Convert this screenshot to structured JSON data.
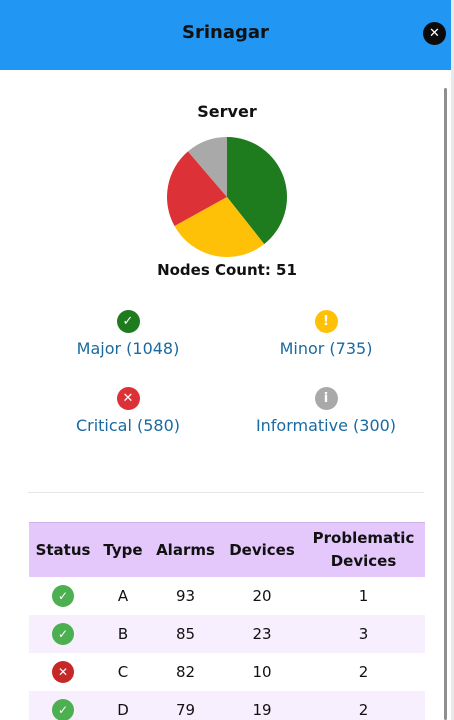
{
  "header": {
    "title": "Srinagar",
    "close_icon": "close-icon"
  },
  "chart": {
    "title": "Server",
    "nodes_count_label": "Nodes Count: 51"
  },
  "chart_data": {
    "type": "pie",
    "title": "Server",
    "slices": [
      {
        "label": "Major",
        "value": 1048,
        "color": "#1e7b1e"
      },
      {
        "label": "Minor",
        "value": 735,
        "color": "#ffc107"
      },
      {
        "label": "Critical",
        "value": 580,
        "color": "#dc3237"
      },
      {
        "label": "Informative",
        "value": 300,
        "color": "#a9a9a9"
      }
    ]
  },
  "legend": [
    {
      "label": "Major (1048)",
      "icon": "check-icon",
      "glyph": "✓",
      "color": "#1e7b1e"
    },
    {
      "label": "Minor (735)",
      "icon": "exclamation-icon",
      "glyph": "!",
      "color": "#ffc107"
    },
    {
      "label": "Critical (580)",
      "icon": "x-icon",
      "glyph": "✕",
      "color": "#dc3237"
    },
    {
      "label": "Informative (300)",
      "icon": "info-icon",
      "glyph": "i",
      "color": "#a9a9a9"
    }
  ],
  "table": {
    "headers": [
      "Status",
      "Type",
      "Alarms",
      "Devices",
      "Problematic Devices"
    ],
    "rows": [
      {
        "status": "ok",
        "type": "A",
        "alarms": "93",
        "devices": "20",
        "problematic": "1"
      },
      {
        "status": "ok",
        "type": "B",
        "alarms": "85",
        "devices": "23",
        "problematic": "3"
      },
      {
        "status": "error",
        "type": "C",
        "alarms": "82",
        "devices": "10",
        "problematic": "2"
      },
      {
        "status": "ok",
        "type": "D",
        "alarms": "79",
        "devices": "19",
        "problematic": "2"
      }
    ]
  },
  "colors": {
    "header": "#2196f3",
    "ok": "#4caf50",
    "error": "#c62828",
    "link": "#1a6aa0",
    "table_header": "#e4c8fb"
  }
}
